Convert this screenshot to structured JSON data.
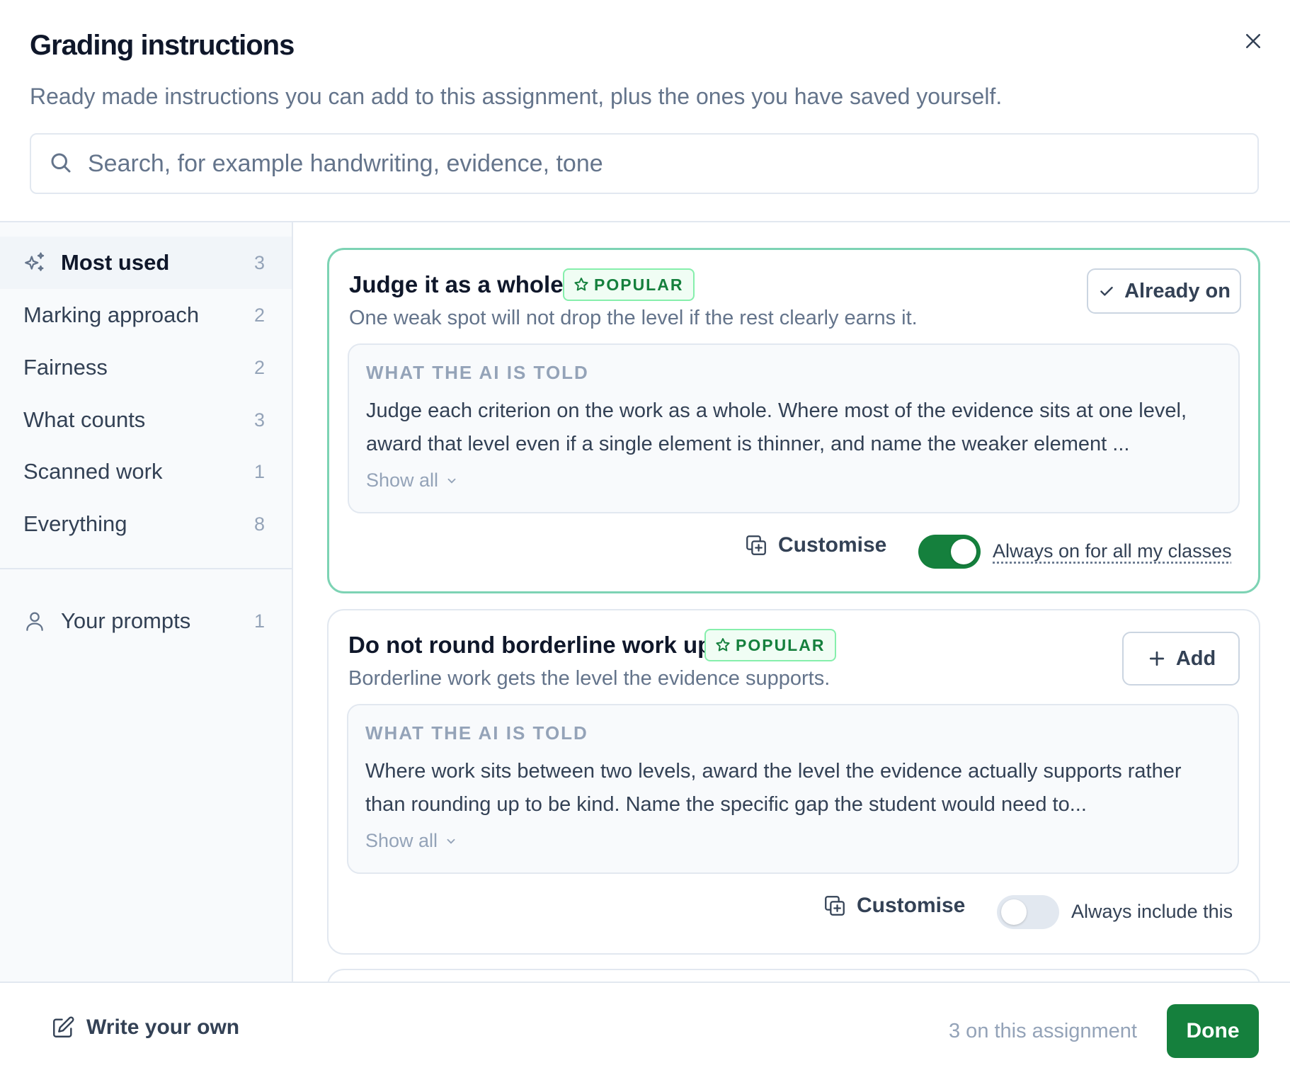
{
  "header": {
    "title": "Grading instructions",
    "subtitle": "Ready made instructions you can add to this assignment, plus the ones you have saved yourself.",
    "search_placeholder": "Search, for example handwriting, evidence, tone",
    "search_value": "",
    "close_icon": "close-icon"
  },
  "sidebar": {
    "categories": [
      {
        "label": "Most used",
        "count": "3",
        "icon": "sparkles-icon",
        "active": true
      },
      {
        "label": "Marking approach",
        "count": "2"
      },
      {
        "label": "Fairness",
        "count": "2"
      },
      {
        "label": "What counts",
        "count": "3"
      },
      {
        "label": "Scanned work",
        "count": "1"
      },
      {
        "label": "Everything",
        "count": "8"
      }
    ],
    "your_prompts": {
      "label": "Your prompts",
      "count": "1",
      "icon": "user-icon"
    }
  },
  "cards": [
    {
      "title": "Judge it as a whole",
      "badge": "POPULAR",
      "description": "One weak spot will not drop the level if the rest clearly earns it.",
      "prompt_label": "WHAT THE AI IS TOLD",
      "prompt_text": "Judge each criterion on the work as a whole. Where most of the evidence sits at one level, award that level even if a single element is thinner, and name the weaker element ...",
      "show_all": "Show all",
      "action_label": "Already on",
      "customise_label": "Customise",
      "toggle_on": true,
      "toggle_label": "Always on for all my classes"
    },
    {
      "title": "Do not round borderline work up",
      "badge": "POPULAR",
      "description": "Borderline work gets the level the evidence supports.",
      "prompt_label": "WHAT THE AI IS TOLD",
      "prompt_text": "Where work sits between two levels, award the level the evidence actually supports rather than rounding up to be kind. Name the specific gap the student would need to...",
      "show_all": "Show all",
      "action_label": "Add",
      "customise_label": "Customise",
      "toggle_on": false,
      "toggle_label": "Always include this"
    }
  ],
  "footer": {
    "write_own": "Write your own",
    "count_text": "3 on this assignment",
    "done": "Done"
  },
  "colors": {
    "accent": "#15803d",
    "selected_border": "#7dd3b4",
    "badge_bg": "#f0fdf4",
    "muted_text": "#64748b"
  }
}
